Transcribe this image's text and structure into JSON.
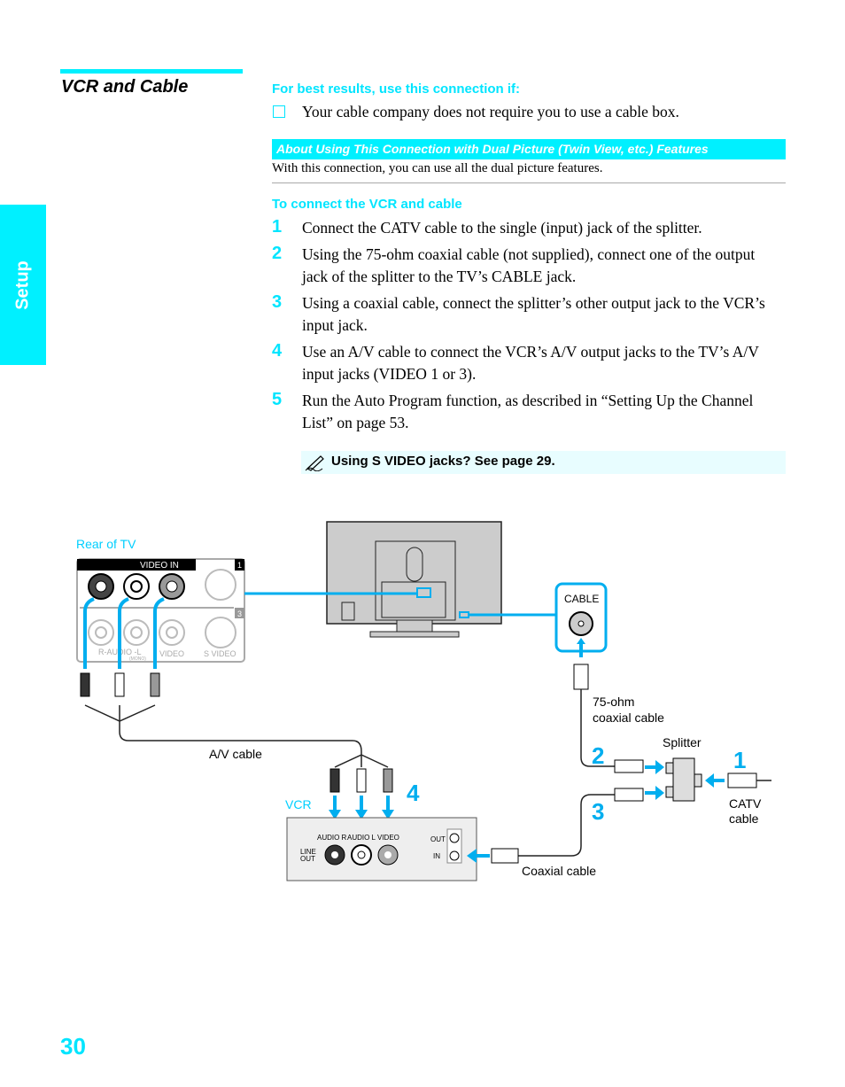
{
  "section": {
    "title": "VCR and Cable",
    "side_tab": "Setup"
  },
  "best_results": {
    "heading": "For best results, use this connection if:",
    "items": [
      "Your cable company does not require you to use a cable box."
    ]
  },
  "about": {
    "heading": "About Using This Connection with Dual Picture (Twin View, etc.) Features",
    "text": "With this connection, you can use all the dual picture features."
  },
  "connect": {
    "heading": "To connect the VCR and cable",
    "steps": [
      {
        "num": "1",
        "text": "Connect the CATV cable to the single (input) jack of the splitter."
      },
      {
        "num": "2",
        "text": "Using the 75-ohm coaxial cable (not supplied), connect one of the output jack of the splitter to the TV’s CABLE jack."
      },
      {
        "num": "3",
        "text": "Using a coaxial cable, connect the splitter’s other output jack to the VCR’s input jack."
      },
      {
        "num": "4",
        "text": "Use an A/V cable to connect the VCR’s A/V output jacks to the TV’s A/V input jacks (VIDEO 1 or 3)."
      },
      {
        "num": "5",
        "text": "Run the Auto Program function, as described in “Setting Up the Channel List” on page 53."
      }
    ]
  },
  "note": {
    "icon": "pencil-note-icon",
    "text": "Using S VIDEO jacks? See page 29."
  },
  "diagram": {
    "rear_of_tv": "Rear of TV",
    "video_in": "VIDEO  IN",
    "input_1": "1",
    "input_3": "3",
    "r_audio_l": "R-AUDIO -L",
    "mono": "(MONO)",
    "video": "VIDEO",
    "s_video": "S  VIDEO",
    "av_cable": "A/V cable",
    "vcr": "VCR",
    "audio_r": "AUDIO R",
    "audio_l": "AUDIO L",
    "vcr_video": "VIDEO",
    "line": "LINE",
    "out": "OUT",
    "vcr_out": "OUT",
    "vcr_in": "IN",
    "cable_jack": "CABLE",
    "coax75_1": "75-ohm",
    "coax75_2": "coaxial cable",
    "splitter": "Splitter",
    "catv_1": "CATV",
    "catv_2": "cable",
    "coaxial_cable": "Coaxial cable",
    "step1": "1",
    "step2": "2",
    "step3": "3",
    "step4": "4"
  },
  "colors": {
    "accent": "#00f0ff",
    "arrow": "#00aeef"
  },
  "page_number": "30"
}
